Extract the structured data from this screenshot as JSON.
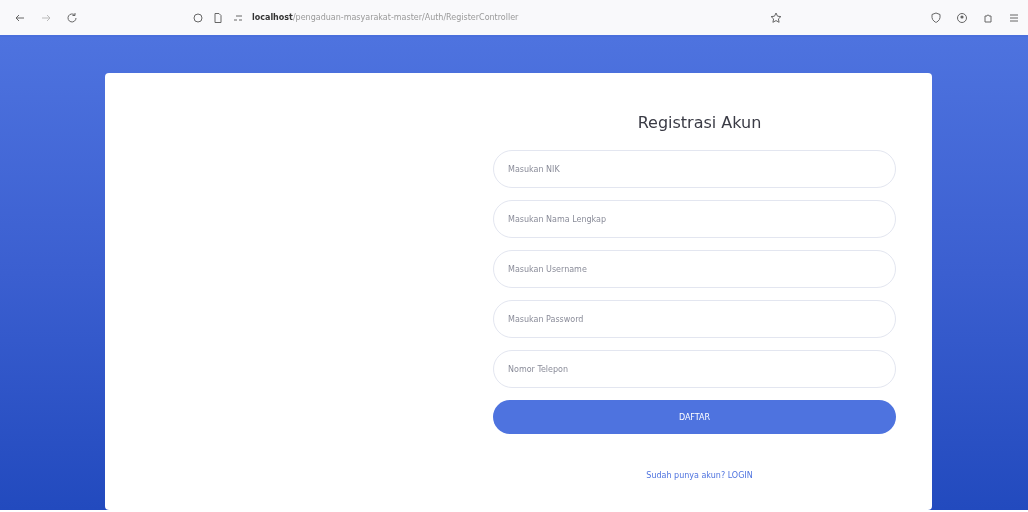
{
  "browser": {
    "url_host": "localhost",
    "url_path": "/pengaduan-masyarakat-master/Auth/RegisterController"
  },
  "form": {
    "title": "Registrasi Akun",
    "fields": [
      {
        "placeholder": "Masukan NIK"
      },
      {
        "placeholder": "Masukan Nama Lengkap"
      },
      {
        "placeholder": "Masukan Username"
      },
      {
        "placeholder": "Masukan Password"
      },
      {
        "placeholder": "Nomor Telepon"
      }
    ],
    "submit": "DAFTAR",
    "login_link": "Sudah punya akun? LOGIN"
  }
}
